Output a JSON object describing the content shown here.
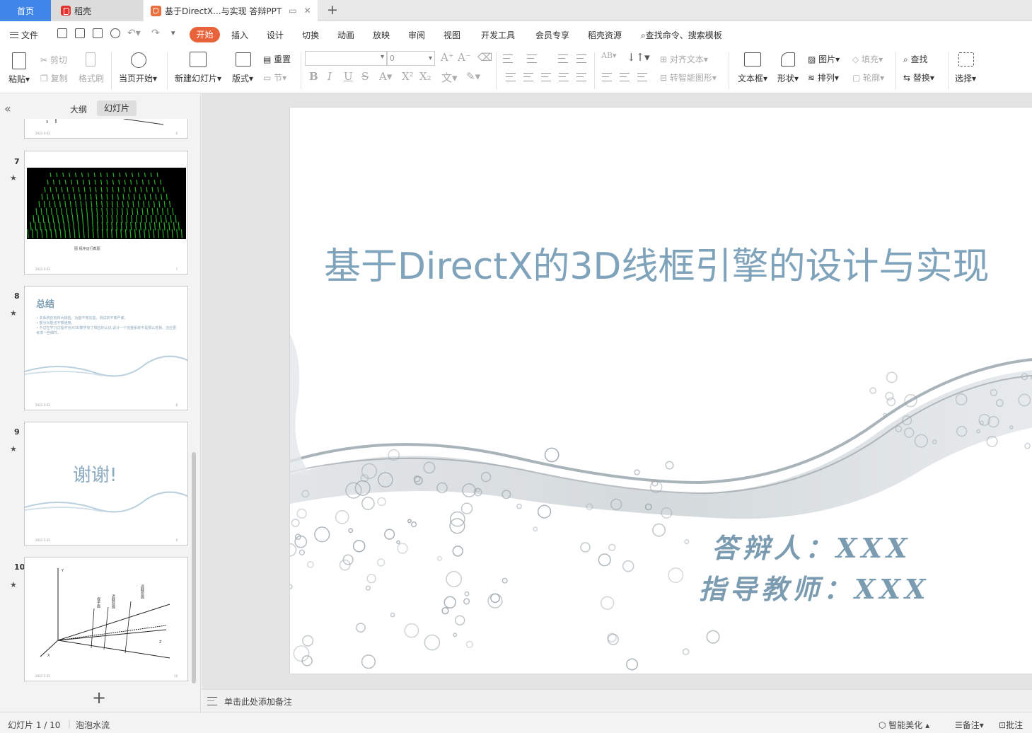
{
  "tabs": {
    "home": "首页",
    "daoke": "稻壳",
    "document": "基于DirectX...与实现 答辩PPT",
    "add": "+"
  },
  "menu": {
    "file": "文件",
    "items": [
      "开始",
      "插入",
      "设计",
      "切换",
      "动画",
      "放映",
      "审阅",
      "视图",
      "开发工具",
      "会员专享",
      "稻壳资源"
    ],
    "search": "查找命令、搜索模板"
  },
  "ribbon": {
    "paste": "粘贴",
    "cut": "剪切",
    "copy": "复制",
    "format_painter": "格式刷",
    "from_current": "当页开始",
    "new_slide": "新建幻灯片",
    "layout": "版式",
    "reset": "重置",
    "section": "节",
    "font_size": "0",
    "align_text": "对齐文本",
    "smartart": "转智能图形",
    "textbox": "文本框",
    "shape": "形状",
    "picture": "图片",
    "arrange": "排列",
    "fill": "填充",
    "outline": "轮廓",
    "find": "查找",
    "replace": "替换",
    "select": "选择"
  },
  "panel": {
    "outline_tab": "大纲",
    "slides_tab": "幻灯片",
    "collapse": "«",
    "add_slide": "+",
    "thumbs": [
      {
        "num": "7",
        "caption": "图 程序运行截图",
        "foot_left": "2022-5-03",
        "foot_right": "7"
      },
      {
        "num": "8",
        "title": "总结",
        "bullets": [
          "本系统仍有较大缺陷，功能不够完善，测试的不够严谨。",
          "部分功能也不够通用。",
          "不过在学习过程中也对3D数学有了相应的认识,设计一个完整系统不是那么容易，还应更考虑一些细节。"
        ],
        "foot_left": "2022-5-03",
        "foot_right": "8"
      },
      {
        "num": "9",
        "title": "谢谢!",
        "foot_left": "2022-5-03",
        "foot_right": "9"
      },
      {
        "num": "10",
        "labels": [
          "Y",
          "X",
          "Z",
          "视平面",
          "近截剪面",
          "远截剪面"
        ],
        "foot_left": "2022-5-03",
        "foot_right": "10"
      }
    ],
    "top_partial": {
      "label": "X",
      "foot_left": "2022-5-03",
      "foot_right": "6"
    }
  },
  "slide": {
    "title": "基于DirectX的3D线框引擎的设计与实现",
    "presenter": "答辩人：XXX",
    "advisor": "指导教师：XXX"
  },
  "notes": {
    "placeholder": "单击此处添加备注"
  },
  "status": {
    "slide_counter": "幻灯片 1 / 10",
    "theme": "泡泡水流",
    "beautify": "智能美化",
    "notes": "备注",
    "comments": "批注"
  }
}
